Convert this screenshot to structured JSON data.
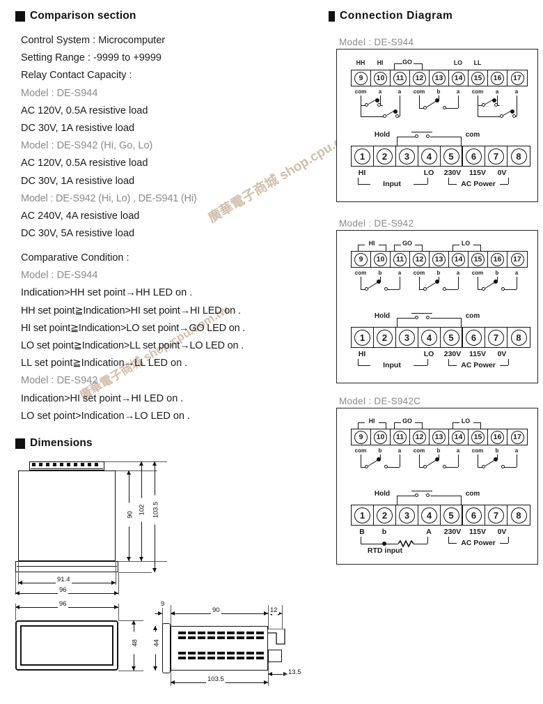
{
  "sections": {
    "comparison": "Comparison section",
    "connection": "Connection  Diagram",
    "dimensions": "Dimensions"
  },
  "comparison": {
    "lines": [
      {
        "text": "Control System   : Microcomputer",
        "style": "normal"
      },
      {
        "text": "Setting Range  : -9999 to +9999",
        "style": "normal"
      },
      {
        "text": "Relay Contact Capacity   :",
        "style": "normal"
      },
      {
        "text": "Model : DE-S944",
        "style": "gray"
      },
      {
        "text": "AC 120V, 0.5A resistive load",
        "style": "normal"
      },
      {
        "text": "DC 30V, 1A resistive load",
        "style": "normal"
      },
      {
        "text": "Model : DE-S942 (Hi, Go, Lo)",
        "style": "gray"
      },
      {
        "text": "AC 120V, 0.5A resistive load",
        "style": "normal"
      },
      {
        "text": "DC 30V, 1A resistive load",
        "style": "normal"
      },
      {
        "text": "Model : DE-S942 (Hi, Lo) , DE-S941 (Hi)",
        "style": "gray"
      },
      {
        "text": "AC 240V, 4A resistive load",
        "style": "normal"
      },
      {
        "text": "DC 30V, 5A resistive load",
        "style": "normal"
      }
    ]
  },
  "comparative": {
    "lines": [
      {
        "text": "Comparative Condition   :",
        "style": "normal"
      },
      {
        "text": "Model : DE-S944",
        "style": "gray"
      },
      {
        "text": "Indication>HH set point→HH LED on .",
        "style": "normal"
      },
      {
        "text": "HH set point≧Indication>HI set point→HI LED on .",
        "style": "normal"
      },
      {
        "text": "HI set point≧Indication>LO set point→GO LED on .",
        "style": "normal"
      },
      {
        "text": "LO set point≧Indication>LL set point→LO LED on .",
        "style": "normal"
      },
      {
        "text": "LL set point≧Indication→LL LED on .",
        "style": "normal"
      },
      {
        "text": "Model : DE-S942",
        "style": "gray"
      },
      {
        "text": "Indication>HI set point→HI LED on .",
        "style": "normal"
      },
      {
        "text": "LO set point>Indication→LO LED on .",
        "style": "normal"
      }
    ]
  },
  "diagrams": [
    {
      "caption": "Model : DE-S944",
      "top": {
        "terminals": [
          "9",
          "10",
          "11",
          "12",
          "13",
          "14",
          "15",
          "16",
          "17"
        ],
        "groups": [
          "HH",
          "HI",
          "GO",
          "LO",
          "LL"
        ],
        "contacts": [
          "com",
          "a",
          "a",
          "com",
          "b",
          "a",
          "com",
          "a",
          "a"
        ]
      },
      "bottom": {
        "terminals": [
          "1",
          "2",
          "3",
          "4",
          "5",
          "6",
          "7",
          "8"
        ],
        "hold_label": "Hold",
        "com_label": "com",
        "pin_labels": [
          "HI",
          "LO",
          "230V",
          "115V",
          "0V"
        ],
        "input_label": "Input",
        "power_label": "AC Power"
      }
    },
    {
      "caption": "Model : DE-S942",
      "top": {
        "terminals": [
          "9",
          "10",
          "11",
          "12",
          "13",
          "14",
          "15",
          "16",
          "17"
        ],
        "groups": [
          "HI",
          "GO",
          "LO"
        ],
        "contacts": [
          "com",
          "b",
          "a",
          "com",
          "b",
          "a",
          "com",
          "b",
          "a"
        ]
      },
      "bottom": {
        "terminals": [
          "1",
          "2",
          "3",
          "4",
          "5",
          "6",
          "7",
          "8"
        ],
        "hold_label": "Hold",
        "com_label": "com",
        "pin_labels": [
          "HI",
          "LO",
          "230V",
          "115V",
          "0V"
        ],
        "input_label": "Input",
        "power_label": "AC Power"
      }
    },
    {
      "caption": "Model : DE-S942C",
      "top": {
        "terminals": [
          "9",
          "10",
          "11",
          "12",
          "13",
          "14",
          "15",
          "16",
          "17"
        ],
        "groups": [
          "HI",
          "GO",
          "LO"
        ],
        "contacts": [
          "com",
          "b",
          "a",
          "com",
          "b",
          "a",
          "com",
          "b",
          "a"
        ]
      },
      "bottom": {
        "terminals": [
          "1",
          "2",
          "3",
          "4",
          "5",
          "6",
          "7",
          "8"
        ],
        "hold_label": "Hold",
        "com_label": "com",
        "pin_labels": [
          "B",
          "b",
          "A",
          "230V",
          "115V",
          "0V"
        ],
        "input_label": "RTD input",
        "power_label": "AC Power"
      }
    }
  ],
  "dimensions": {
    "top_view": {
      "vertical": [
        "90",
        "102",
        "103.5"
      ],
      "horizontal": [
        "91.4",
        "96"
      ]
    },
    "front_view": {
      "width": "96",
      "height": "48",
      "inner_height": "44"
    },
    "side_view": {
      "bezel": "9",
      "body": "90",
      "tail": "12",
      "total": "103.5",
      "panel": "13.5"
    }
  },
  "watermark": {
    "line1": "廣華電子商城 shop.cpu.com.tw",
    "line2": "廣華電子商城 shop.cpu.com.tw"
  }
}
